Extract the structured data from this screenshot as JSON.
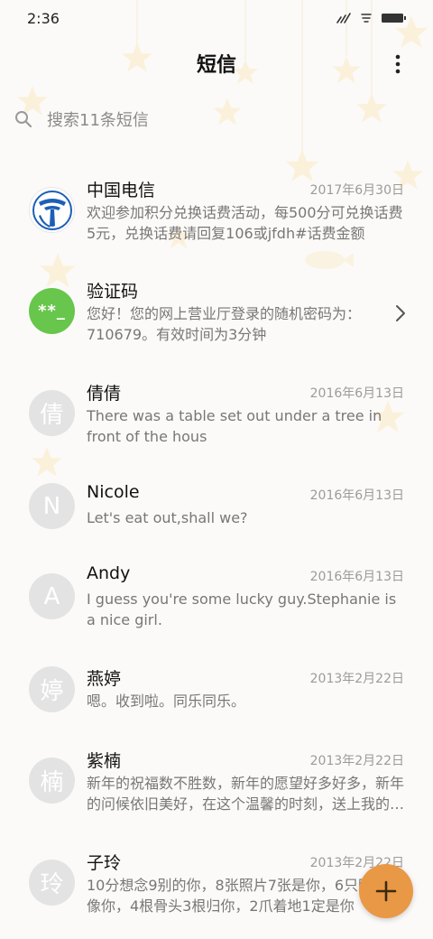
{
  "status_bar": {
    "time": "2:36"
  },
  "header": {
    "title": "短信"
  },
  "search": {
    "placeholder": "搜索11条短信"
  },
  "conversations": [
    {
      "name": "中国电信",
      "date": "2017年6月30日",
      "preview": "欢迎参加积分兑换话费活动，每500分可兑换话费5元，兑换话费请回复106或jfdh#话费金额",
      "avatar": "telecom-logo"
    },
    {
      "name": "验证码",
      "date": "",
      "preview": "您好！您的网上营业厅登录的随机密码为：710679。有效时间为3分钟",
      "avatar_text": "**_",
      "avatar_color": "#67c64b"
    },
    {
      "name": "倩倩",
      "date": "2016年6月13日",
      "preview": "There was a table set out under a tree in front of the hous",
      "avatar_text": "倩"
    },
    {
      "name": "Nicole",
      "date": "2016年6月13日",
      "preview": "Let's eat out,shall we?",
      "avatar_text": "N"
    },
    {
      "name": "Andy",
      "date": "2016年6月13日",
      "preview": "I guess you're some lucky guy.Stephanie is a nice girl.",
      "avatar_text": "A"
    },
    {
      "name": "燕婷",
      "date": "2013年2月22日",
      "preview": "嗯。收到啦。同乐同乐。",
      "avatar_text": "婷"
    },
    {
      "name": "紫楠",
      "date": "2013年2月22日",
      "preview": "新年的祝福数不胜数，新年的愿望好多好多，新年的问候依旧美好，在这个温馨的时刻，送上我的祝福",
      "avatar_text": "楠"
    },
    {
      "name": "子玲",
      "date": "2013年2月22日",
      "preview": "10分想念9别的你，8张照片7张是你，6只眼睛只像你，4根骨头3根归你，2爪着地1定是你",
      "avatar_text": "玲"
    }
  ],
  "colors": {
    "fab": "#e99846",
    "verify_avatar": "#67c64b",
    "telecom_blue": "#1d5fb5"
  },
  "icons": {
    "more": "more-vertical-icon",
    "search": "search-icon",
    "chevron": "chevron-right-icon",
    "fab": "plus-icon"
  }
}
